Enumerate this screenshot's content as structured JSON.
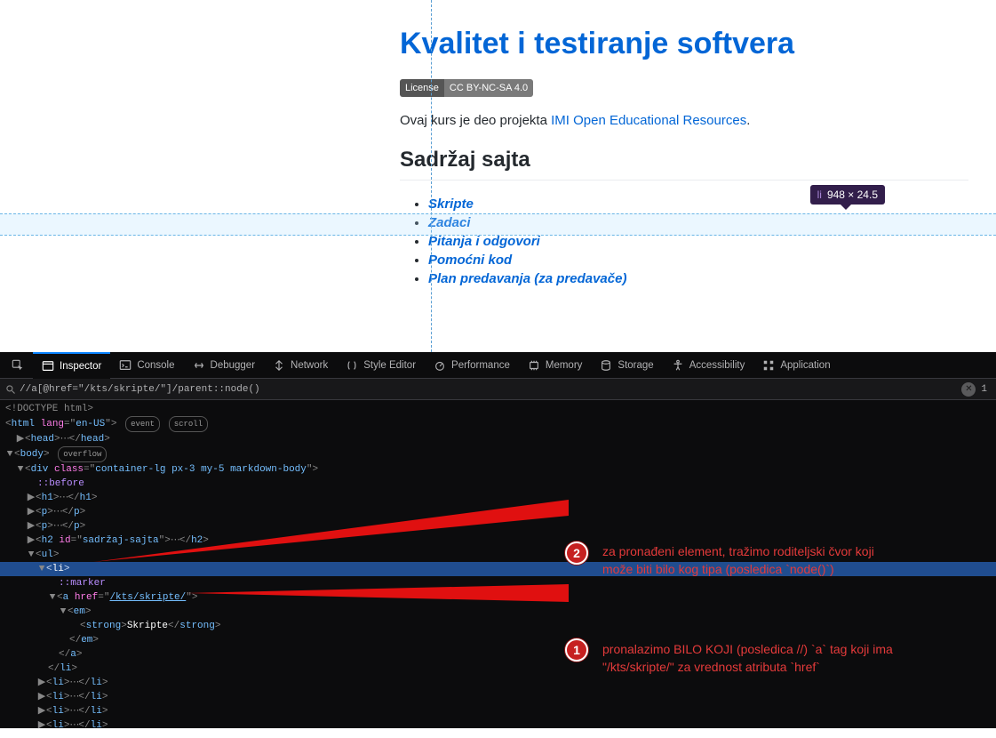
{
  "page": {
    "title": "Kvalitet i testiranje softvera",
    "badge_left": "License",
    "badge_right": "CC BY-NC-SA 4.0",
    "intro_prefix": "Ovaj kurs je deo projekta ",
    "intro_link": "IMI Open Educational Resources",
    "intro_suffix": ".",
    "h2": "Sadržaj sajta",
    "links": [
      "Skripte",
      "Zadaci",
      "Pitanja i odgovori",
      "Pomoćni kod",
      "Plan predavanja (za predavače)"
    ]
  },
  "overlay": {
    "tag": "li",
    "dims": "948 × 24.5"
  },
  "devtools": {
    "tabs": [
      "Inspector",
      "Console",
      "Debugger",
      "Network",
      "Style Editor",
      "Performance",
      "Memory",
      "Storage",
      "Accessibility",
      "Application"
    ],
    "search_value": "//a[@href=\"/kts/skripte/\"]/parent::node()",
    "search_count": "1",
    "tree": {
      "doctype": "<!DOCTYPE html>",
      "html_lang": "en-US",
      "pills": {
        "event": "event",
        "scroll": "scroll",
        "overflow": "overflow"
      },
      "div_class": "container-lg px-3 my-5 markdown-body",
      "before": "::before",
      "h2_id": "sadržaj-sajta",
      "marker": "::marker",
      "a_href": "/kts/skripte/",
      "strong_text": "Skripte"
    }
  },
  "annotations": {
    "n1": "1",
    "n2": "2",
    "text1_l1": "pronalazimo BILO KOJI (posledica //) `a` tag koji ima",
    "text1_l2": "\"/kts/skripte/\" za vrednost atributa `href`",
    "text2_l1": "za pronađeni element, tražimo roditeljski čvor koji",
    "text2_l2": "može biti bilo kog tipa (posledica `node()`)"
  }
}
